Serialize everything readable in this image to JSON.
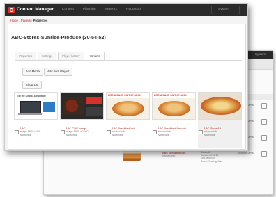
{
  "front_window": {
    "app_title": "Content Manager",
    "nav": [
      "Content",
      "Planning",
      "Network",
      "Reporting"
    ],
    "system_label": "System",
    "breadcrumb": {
      "part1": "Home",
      "part2": "Players",
      "current": "Properties"
    },
    "page_title": "ABC-Stores-Sunrise-Produce (30-54-52)",
    "tabs": [
      "Properties",
      "Settings",
      "Player history",
      "Variants"
    ],
    "active_tab_index": 3,
    "buttons": {
      "add_media": "Add Media",
      "add_from_playlist": "Add from Playlist",
      "show_list": "Show List"
    },
    "cards": [
      {
        "name": "ABC",
        "sub": "Image 1920 x 108",
        "status": "Approved",
        "promo": "",
        "img": "laptop"
      },
      {
        "name": "ABC CMS Image",
        "sub": "Image 1920 x 1080",
        "status": "Approved",
        "promo": "",
        "img": "steak"
      },
      {
        "name": "ABC Breakfast Ind.",
        "sub": "Infused Info",
        "status": "Approved",
        "promo": "BREAKFAST ON THE DECK",
        "img": "pancake"
      },
      {
        "name": "ABC Breakfast Second",
        "sub": "Infused Info",
        "status": "Approved",
        "promo": "BREAKFAST ON THE DECK",
        "img": "pancake"
      },
      {
        "name": "ABC Pizza Ad",
        "sub": "Infused Info",
        "status": "Approved",
        "promo": "",
        "img": "pizza"
      }
    ]
  },
  "back_window": {
    "system_label": "System",
    "col_header": "Modified",
    "rows": [
      {
        "name": "",
        "sub": "",
        "meta": "Status: A\nDuration: 0:00:10\nEnd: 00/00/00\nScreen Sharing: Auto",
        "date": "00/00/00 00:00",
        "img": "pancake"
      },
      {
        "name": "ABC Breakfast Ind.",
        "sub": "Infused Info",
        "meta": "Status: A\nDuration: 0:00:10\nEnd: 00/00/00\nScreen Sharing: Auto",
        "date": "00/00/00 00:00",
        "img": "pancake"
      },
      {
        "name": "ABC Breakfast Ind.",
        "sub": "Infused Info",
        "meta": "Status: A\nDuration: 0:00:10\nEnd: 00/00/00\nScreen Sharing: Auto",
        "date": "00/00/00 00:00",
        "img": "pancake"
      },
      {
        "name": "ABC Breakfast Ind.",
        "sub": "Infused Info",
        "meta": "Status: A\nDuration: 0:00:10\nEnd: 00/00/00\nScreen Sharing: Auto",
        "date": "00/00/00 00:00",
        "img": "pancake"
      }
    ]
  },
  "colors": {
    "brand_red": "#d6312b",
    "topbar": "#2b2b2b",
    "link_red": "#b8332b"
  }
}
